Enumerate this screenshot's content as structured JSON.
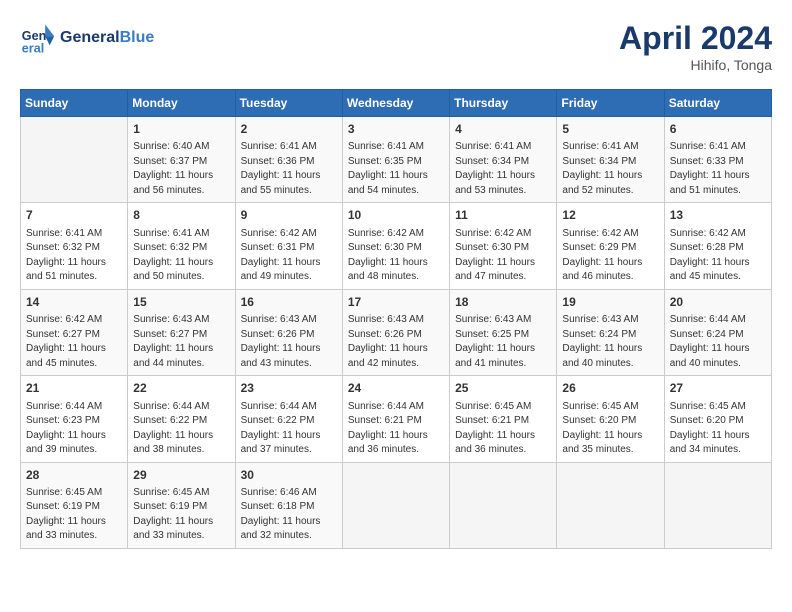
{
  "header": {
    "logo_line1": "General",
    "logo_line2": "Blue",
    "month_title": "April 2024",
    "location": "Hihifo, Tonga"
  },
  "days_of_week": [
    "Sunday",
    "Monday",
    "Tuesday",
    "Wednesday",
    "Thursday",
    "Friday",
    "Saturday"
  ],
  "weeks": [
    [
      {
        "day": "",
        "info": ""
      },
      {
        "day": "1",
        "info": "Sunrise: 6:40 AM\nSunset: 6:37 PM\nDaylight: 11 hours\nand 56 minutes."
      },
      {
        "day": "2",
        "info": "Sunrise: 6:41 AM\nSunset: 6:36 PM\nDaylight: 11 hours\nand 55 minutes."
      },
      {
        "day": "3",
        "info": "Sunrise: 6:41 AM\nSunset: 6:35 PM\nDaylight: 11 hours\nand 54 minutes."
      },
      {
        "day": "4",
        "info": "Sunrise: 6:41 AM\nSunset: 6:34 PM\nDaylight: 11 hours\nand 53 minutes."
      },
      {
        "day": "5",
        "info": "Sunrise: 6:41 AM\nSunset: 6:34 PM\nDaylight: 11 hours\nand 52 minutes."
      },
      {
        "day": "6",
        "info": "Sunrise: 6:41 AM\nSunset: 6:33 PM\nDaylight: 11 hours\nand 51 minutes."
      }
    ],
    [
      {
        "day": "7",
        "info": "Sunrise: 6:41 AM\nSunset: 6:32 PM\nDaylight: 11 hours\nand 51 minutes."
      },
      {
        "day": "8",
        "info": "Sunrise: 6:41 AM\nSunset: 6:32 PM\nDaylight: 11 hours\nand 50 minutes."
      },
      {
        "day": "9",
        "info": "Sunrise: 6:42 AM\nSunset: 6:31 PM\nDaylight: 11 hours\nand 49 minutes."
      },
      {
        "day": "10",
        "info": "Sunrise: 6:42 AM\nSunset: 6:30 PM\nDaylight: 11 hours\nand 48 minutes."
      },
      {
        "day": "11",
        "info": "Sunrise: 6:42 AM\nSunset: 6:30 PM\nDaylight: 11 hours\nand 47 minutes."
      },
      {
        "day": "12",
        "info": "Sunrise: 6:42 AM\nSunset: 6:29 PM\nDaylight: 11 hours\nand 46 minutes."
      },
      {
        "day": "13",
        "info": "Sunrise: 6:42 AM\nSunset: 6:28 PM\nDaylight: 11 hours\nand 45 minutes."
      }
    ],
    [
      {
        "day": "14",
        "info": "Sunrise: 6:42 AM\nSunset: 6:27 PM\nDaylight: 11 hours\nand 45 minutes."
      },
      {
        "day": "15",
        "info": "Sunrise: 6:43 AM\nSunset: 6:27 PM\nDaylight: 11 hours\nand 44 minutes."
      },
      {
        "day": "16",
        "info": "Sunrise: 6:43 AM\nSunset: 6:26 PM\nDaylight: 11 hours\nand 43 minutes."
      },
      {
        "day": "17",
        "info": "Sunrise: 6:43 AM\nSunset: 6:26 PM\nDaylight: 11 hours\nand 42 minutes."
      },
      {
        "day": "18",
        "info": "Sunrise: 6:43 AM\nSunset: 6:25 PM\nDaylight: 11 hours\nand 41 minutes."
      },
      {
        "day": "19",
        "info": "Sunrise: 6:43 AM\nSunset: 6:24 PM\nDaylight: 11 hours\nand 40 minutes."
      },
      {
        "day": "20",
        "info": "Sunrise: 6:44 AM\nSunset: 6:24 PM\nDaylight: 11 hours\nand 40 minutes."
      }
    ],
    [
      {
        "day": "21",
        "info": "Sunrise: 6:44 AM\nSunset: 6:23 PM\nDaylight: 11 hours\nand 39 minutes."
      },
      {
        "day": "22",
        "info": "Sunrise: 6:44 AM\nSunset: 6:22 PM\nDaylight: 11 hours\nand 38 minutes."
      },
      {
        "day": "23",
        "info": "Sunrise: 6:44 AM\nSunset: 6:22 PM\nDaylight: 11 hours\nand 37 minutes."
      },
      {
        "day": "24",
        "info": "Sunrise: 6:44 AM\nSunset: 6:21 PM\nDaylight: 11 hours\nand 36 minutes."
      },
      {
        "day": "25",
        "info": "Sunrise: 6:45 AM\nSunset: 6:21 PM\nDaylight: 11 hours\nand 36 minutes."
      },
      {
        "day": "26",
        "info": "Sunrise: 6:45 AM\nSunset: 6:20 PM\nDaylight: 11 hours\nand 35 minutes."
      },
      {
        "day": "27",
        "info": "Sunrise: 6:45 AM\nSunset: 6:20 PM\nDaylight: 11 hours\nand 34 minutes."
      }
    ],
    [
      {
        "day": "28",
        "info": "Sunrise: 6:45 AM\nSunset: 6:19 PM\nDaylight: 11 hours\nand 33 minutes."
      },
      {
        "day": "29",
        "info": "Sunrise: 6:45 AM\nSunset: 6:19 PM\nDaylight: 11 hours\nand 33 minutes."
      },
      {
        "day": "30",
        "info": "Sunrise: 6:46 AM\nSunset: 6:18 PM\nDaylight: 11 hours\nand 32 minutes."
      },
      {
        "day": "",
        "info": ""
      },
      {
        "day": "",
        "info": ""
      },
      {
        "day": "",
        "info": ""
      },
      {
        "day": "",
        "info": ""
      }
    ]
  ]
}
